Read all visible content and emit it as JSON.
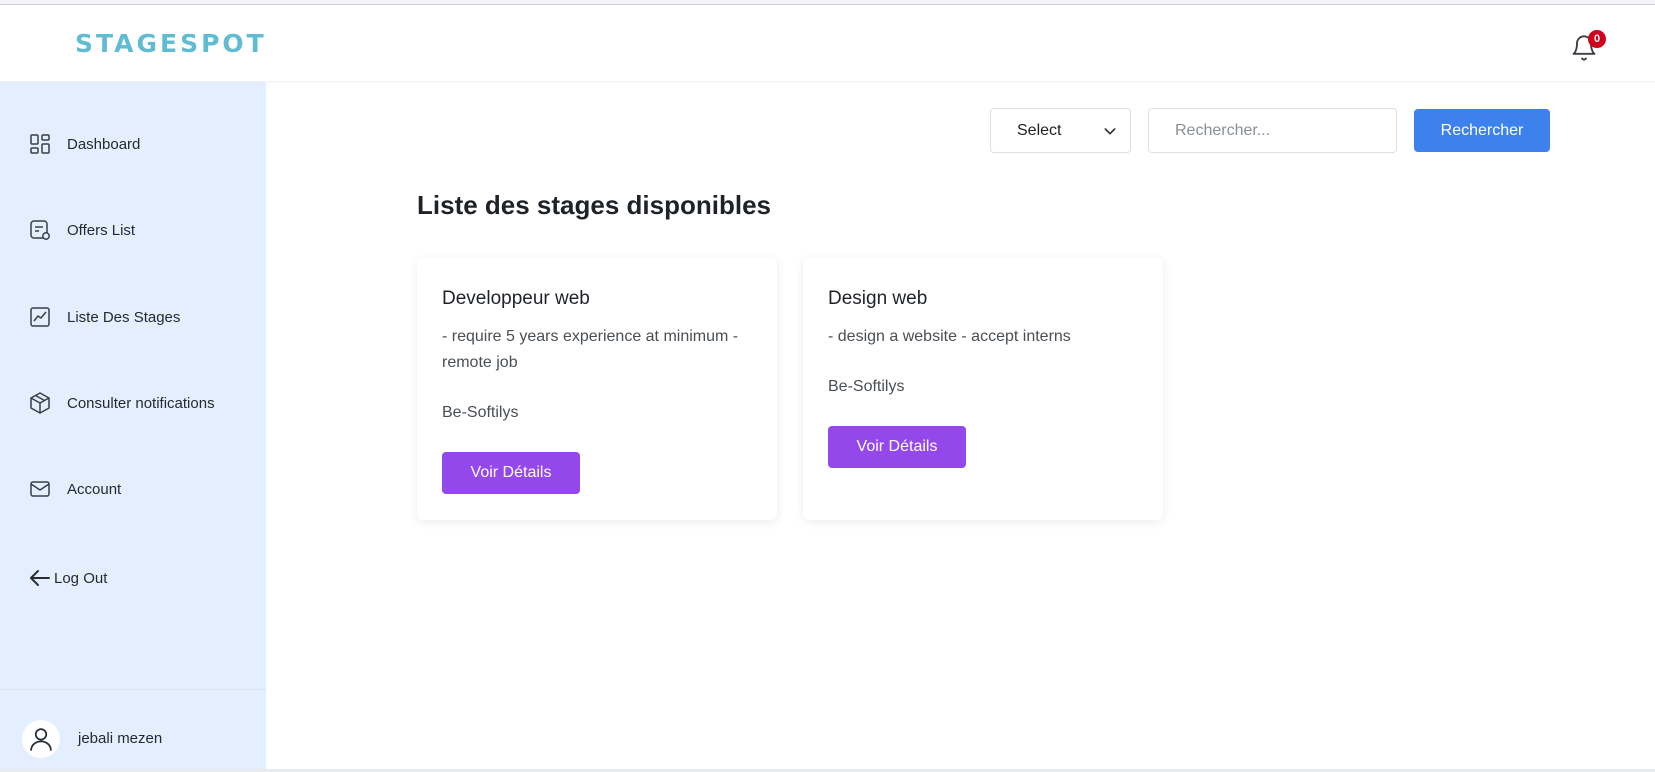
{
  "app": {
    "logo": "STAGESPOT"
  },
  "header": {
    "notification_count": "0"
  },
  "sidebar": {
    "items": [
      {
        "label": "Dashboard",
        "icon": "dashboard-icon"
      },
      {
        "label": "Offers List",
        "icon": "offers-icon"
      },
      {
        "label": "Liste Des Stages",
        "icon": "chart-icon"
      },
      {
        "label": "Consulter notifications",
        "icon": "box-icon"
      },
      {
        "label": "Account",
        "icon": "mail-icon"
      }
    ],
    "logout_label": "Log Out",
    "user_name": "jebali mezen"
  },
  "toolbar": {
    "select_value": "Select",
    "search_placeholder": "Rechercher...",
    "search_button": "Rechercher"
  },
  "main": {
    "title": "Liste des stages disponibles",
    "cards": [
      {
        "title": "Developpeur web",
        "description": "- require 5 years experience at minimum - remote job",
        "company": "Be-Softilys",
        "button": "Voir Détails"
      },
      {
        "title": "Design web",
        "description": "- design a website - accept interns",
        "company": "Be-Softilys",
        "button": "Voir Détails"
      }
    ]
  },
  "colors": {
    "logo": "#5fbcd3",
    "sidebar_bg": "#e3efff",
    "primary_button": "#3d82ec",
    "card_button": "#9448ec",
    "badge": "#d0021b"
  }
}
